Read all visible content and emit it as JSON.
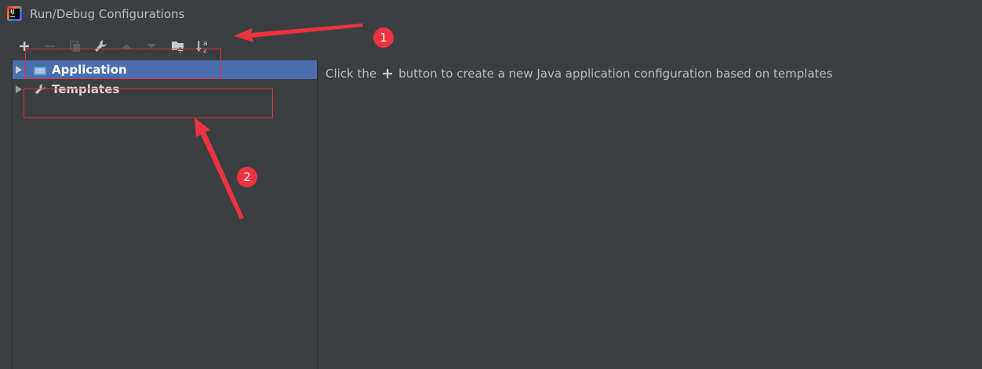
{
  "window": {
    "title": "Run/Debug Configurations",
    "app_icon_text": "IJ"
  },
  "toolbar": {
    "buttons": [
      {
        "name": "add",
        "icon": "plus-icon",
        "enabled": true
      },
      {
        "name": "remove",
        "icon": "minus-icon",
        "enabled": false
      },
      {
        "name": "copy",
        "icon": "copy-icon",
        "enabled": false
      },
      {
        "name": "edit-templates",
        "icon": "wrench-icon",
        "enabled": true
      },
      {
        "name": "move-up",
        "icon": "arrow-up-icon",
        "enabled": false
      },
      {
        "name": "move-down",
        "icon": "arrow-down-icon",
        "enabled": false
      },
      {
        "name": "new-folder",
        "icon": "folder-add-icon",
        "enabled": true
      },
      {
        "name": "sort",
        "icon": "sort-alpha-icon",
        "enabled": true
      }
    ],
    "sort_label_top": "a",
    "sort_label_bottom": "z"
  },
  "tree": {
    "items": [
      {
        "label": "Application",
        "icon": "application-icon",
        "selected": true,
        "collapsed": true
      },
      {
        "label": "Templates",
        "icon": "wrench-icon",
        "selected": false,
        "collapsed": true
      }
    ]
  },
  "main": {
    "hint_before": "Click the",
    "hint_after": "button to create a new Java application configuration based on templates"
  },
  "annotations": {
    "badge1": "1",
    "badge2": "2",
    "color": "#ee3340"
  },
  "colors": {
    "background": "#3c3f41",
    "selection": "#4b6eaf",
    "text": "#bbbbbb"
  }
}
